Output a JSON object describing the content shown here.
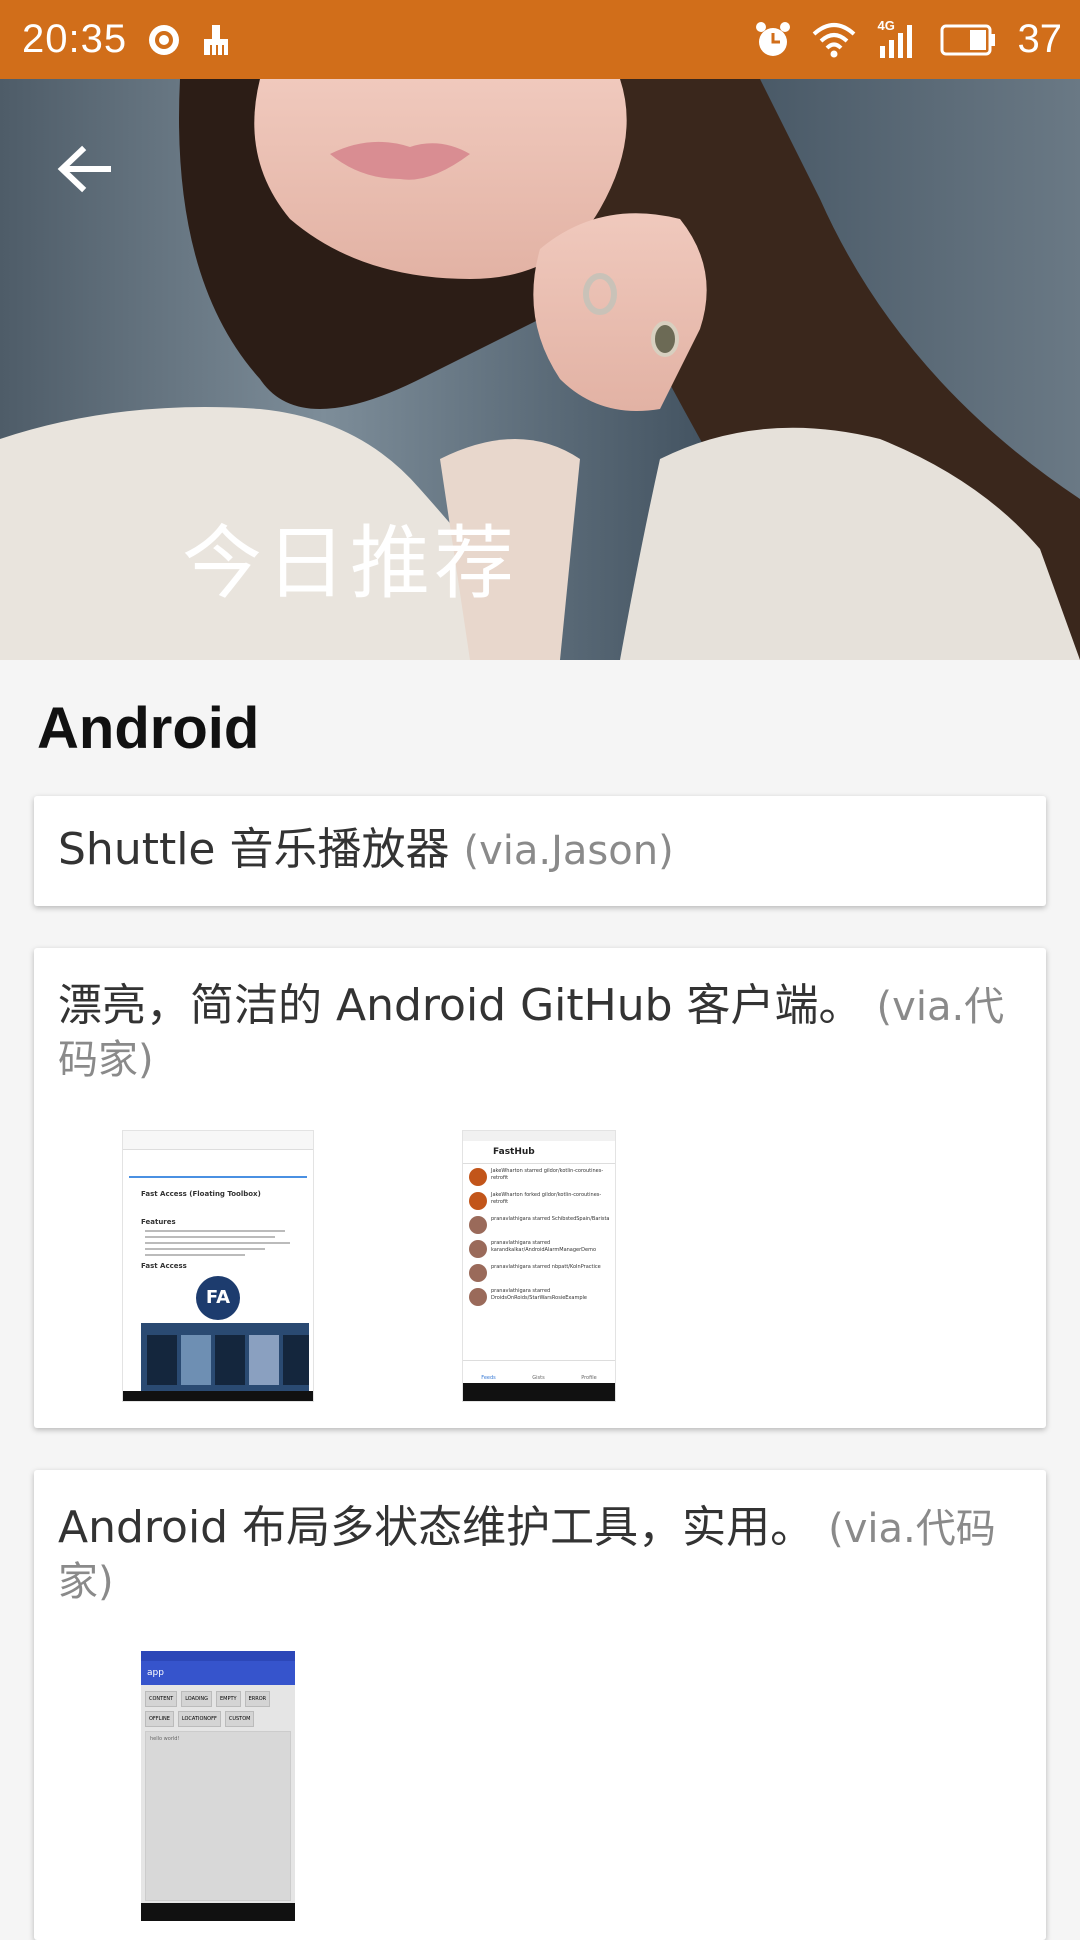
{
  "status_bar": {
    "time": "20:35",
    "network": "4G",
    "battery": "37"
  },
  "hero": {
    "title": "今日推荐"
  },
  "section": {
    "title": "Android"
  },
  "cards": [
    {
      "text": "Shuttle 音乐播放器",
      "via": "(via.Jason)"
    },
    {
      "text": "漂亮，简洁的 Android GitHub 客户端。",
      "via": "(via.代码家)",
      "screenshots": [
        {
          "app": "FastHub",
          "heading": "Fast Access (Floating Toolbox)",
          "features_label": "Features",
          "fast_access_label": "Fast Access",
          "logo_text": "FA"
        },
        {
          "app": "FastHub",
          "feed": [
            "JakeWharton starred gildor/kotlin-coroutines-retrofit",
            "JakeWharton forked gildor/kotlin-coroutines-retrofit",
            "pranavlathigara starred SchibstedSpain/Barista",
            "pranavlathigara starred karandkalkar/AndroidAlarmManagerDemo",
            "pranavlathigara starred nbpatt/KoInPractice",
            "pranavlathigara starred DroidsOnRoids/StarWarsRosieExample"
          ],
          "tabs": [
            "Feeds",
            "Gists",
            "Profile"
          ]
        }
      ]
    },
    {
      "text": "Android 布局多状态维护工具，实用。",
      "via": "(via.代码家)",
      "screenshots": [
        {
          "app": "app",
          "buttons": [
            "CONTENT",
            "LOADING",
            "EMPTY",
            "ERROR",
            "OFFLINE",
            "LOCATIONOFF",
            "CUSTOM"
          ],
          "body_text": "hello world!"
        }
      ]
    }
  ]
}
